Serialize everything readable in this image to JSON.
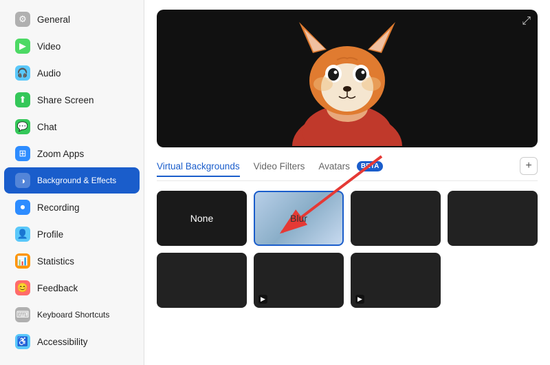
{
  "sidebar": {
    "items": [
      {
        "id": "general",
        "label": "General",
        "icon": "⚙",
        "iconClass": "icon-general",
        "active": false
      },
      {
        "id": "video",
        "label": "Video",
        "icon": "▶",
        "iconClass": "icon-video",
        "active": false
      },
      {
        "id": "audio",
        "label": "Audio",
        "icon": "🎧",
        "iconClass": "icon-audio",
        "active": false
      },
      {
        "id": "share-screen",
        "label": "Share Screen",
        "icon": "↑",
        "iconClass": "icon-share",
        "active": false
      },
      {
        "id": "chat",
        "label": "Chat",
        "icon": "💬",
        "iconClass": "icon-chat",
        "active": false
      },
      {
        "id": "zoom-apps",
        "label": "Zoom Apps",
        "icon": "⊞",
        "iconClass": "icon-zoom",
        "active": false
      },
      {
        "id": "background",
        "label": "Background & Effects",
        "icon": "◑",
        "iconClass": "icon-bg",
        "active": true
      },
      {
        "id": "recording",
        "label": "Recording",
        "icon": "⏺",
        "iconClass": "icon-recording",
        "active": false
      },
      {
        "id": "profile",
        "label": "Profile",
        "icon": "👤",
        "iconClass": "icon-profile",
        "active": false
      },
      {
        "id": "statistics",
        "label": "Statistics",
        "icon": "📊",
        "iconClass": "icon-stats",
        "active": false
      },
      {
        "id": "feedback",
        "label": "Feedback",
        "icon": "😊",
        "iconClass": "icon-feedback",
        "active": false
      },
      {
        "id": "keyboard",
        "label": "Keyboard Shortcuts",
        "icon": "⌨",
        "iconClass": "icon-keyboard",
        "active": false
      },
      {
        "id": "accessibility",
        "label": "Accessibility",
        "icon": "♿",
        "iconClass": "icon-accessibility",
        "active": false
      }
    ]
  },
  "main": {
    "tabs": [
      {
        "id": "virtual-backgrounds",
        "label": "Virtual Backgrounds",
        "active": true
      },
      {
        "id": "video-filters",
        "label": "Video Filters",
        "active": false
      },
      {
        "id": "avatars",
        "label": "Avatars",
        "active": false
      }
    ],
    "beta_label": "BETA",
    "add_label": "+",
    "expand_icon": "⤢",
    "backgrounds": [
      {
        "id": "none",
        "label": "None",
        "type": "none",
        "selected": false
      },
      {
        "id": "blur",
        "label": "Blur",
        "type": "blur",
        "selected": true
      },
      {
        "id": "bridge",
        "label": "",
        "type": "image-bridge",
        "selected": false
      },
      {
        "id": "nature",
        "label": "",
        "type": "image-nature",
        "selected": false
      },
      {
        "id": "space",
        "label": "",
        "type": "image-space",
        "selected": false
      },
      {
        "id": "aurora",
        "label": "",
        "type": "image-aurora",
        "selected": false,
        "hasVideo": true
      },
      {
        "id": "beach",
        "label": "",
        "type": "image-beach",
        "selected": false,
        "hasVideo": true
      }
    ]
  }
}
